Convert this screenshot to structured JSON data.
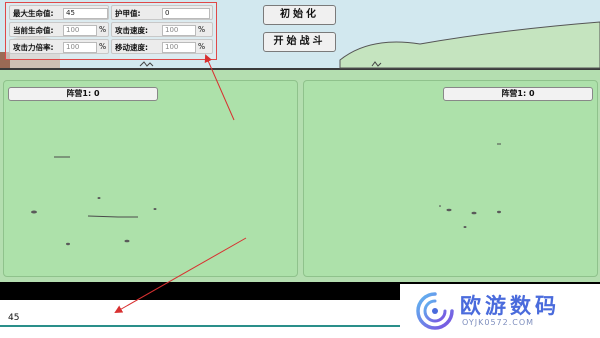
{
  "settings": {
    "max_hp_label": "最大生命值:",
    "max_hp_value": "45",
    "armor_label": "护甲值:",
    "armor_value": "0",
    "current_hp_label": "当前生命值:",
    "current_hp_placeholder": "100",
    "current_hp_unit": "%",
    "attack_speed_label": "攻击速度:",
    "attack_speed_placeholder": "100",
    "attack_speed_unit": "%",
    "attack_mult_label": "攻击力倍率:",
    "attack_mult_placeholder": "100",
    "attack_mult_unit": "%",
    "move_speed_label": "移动速度:",
    "move_speed_placeholder": "100",
    "move_speed_unit": "%"
  },
  "buttons": {
    "init_label": "初始化",
    "start_label": "开始战斗"
  },
  "teams": {
    "left_label": "阵营1: 0",
    "right_label": "阵营1: 0"
  },
  "console": {
    "value": "45"
  },
  "watermark": {
    "text": "欧游数码",
    "sub": "OYJK0572.COM"
  },
  "colors": {
    "sky": "#d2e8ef",
    "ground": "#b4deb0",
    "panel": "#ade1aa",
    "highlight": "#e04848",
    "annotation_arrow": "#d83030",
    "console_line": "#2a8f8a",
    "watermark": "#4a6bdc"
  }
}
